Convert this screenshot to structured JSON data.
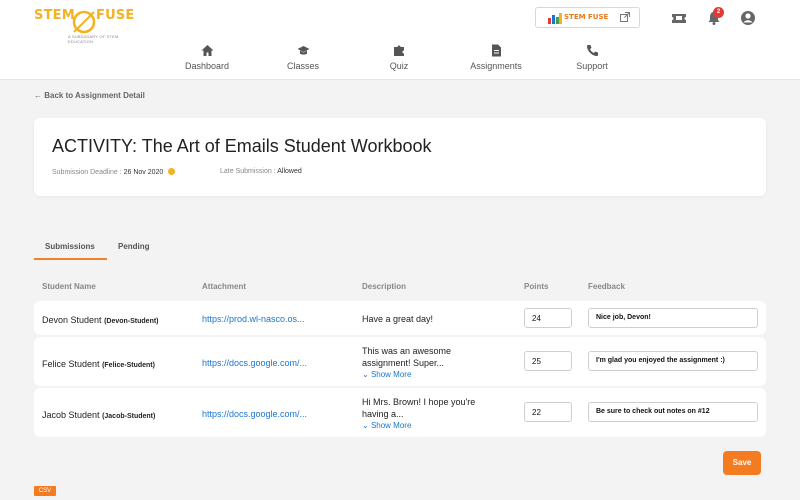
{
  "brand": {
    "logo_left": "STEM",
    "logo_right": "FUSE",
    "tagline": "A SUBSIDIARY OF STEM EDUCATION",
    "chip_text": "STEM FUSE",
    "colors": {
      "accent": "#f47b20",
      "logo": "#f4b223",
      "link": "#1976d2",
      "badge": "#e53935"
    }
  },
  "header": {
    "notification_count": "2",
    "icons": [
      "ticket-icon",
      "bell-icon",
      "user-circle-icon"
    ]
  },
  "nav": [
    {
      "label": "Dashboard",
      "icon": "home-icon"
    },
    {
      "label": "Classes",
      "icon": "graduation-cap-icon"
    },
    {
      "label": "Quiz",
      "icon": "puzzle-icon"
    },
    {
      "label": "Assignments",
      "icon": "document-icon"
    },
    {
      "label": "Support",
      "icon": "phone-icon"
    }
  ],
  "back_link": "Back to Assignment Detail",
  "activity": {
    "title": "ACTIVITY: The Art of Emails Student Workbook",
    "deadline_label": "Submission Deadline :",
    "deadline_value": "26 Nov 2020",
    "late_label": "Late Submission :",
    "late_value": "Allowed"
  },
  "tabs": [
    {
      "label": "Submissions",
      "active": true
    },
    {
      "label": "Pending",
      "active": false
    }
  ],
  "table": {
    "headers": [
      "Student Name",
      "Attachment",
      "Description",
      "Points",
      "Feedback"
    ],
    "rows": [
      {
        "name": "Devon Student",
        "username": "(Devon-Student)",
        "attachment": "https://prod.wl-nasco.os...",
        "description": "Have a great day!",
        "show_more": "",
        "points": "24",
        "feedback": "Nice job, Devon!"
      },
      {
        "name": "Felice Student",
        "username": "(Felice-Student)",
        "attachment": "https://docs.google.com/...",
        "description": "This was an awesome assignment! Super...",
        "show_more": "Show More",
        "points": "25",
        "feedback": "I'm glad you enjoyed the assignment :)"
      },
      {
        "name": "Jacob Student",
        "username": "(Jacob-Student)",
        "attachment": "https://docs.google.com/...",
        "description": "Hi Mrs. Brown! I hope you're having a...",
        "show_more": "Show More",
        "points": "22",
        "feedback": "Be sure to check out notes on #12"
      }
    ]
  },
  "save_label": "Save",
  "csv_label": "CSV"
}
